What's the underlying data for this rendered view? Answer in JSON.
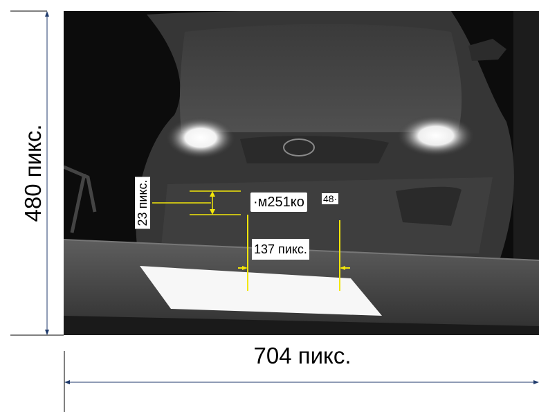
{
  "diagram": {
    "image_height_label": "480 пикс.",
    "image_width_label": "704 пикс.",
    "plate_height_label": "23 пикс.",
    "plate_width_label": "137 пикс."
  },
  "plate": {
    "number": "·м251ко",
    "region": "48·"
  },
  "colors": {
    "annotation_yellow": "#f2e60a",
    "dimension_line": "#1f3a6b",
    "background": "#ffffff"
  }
}
